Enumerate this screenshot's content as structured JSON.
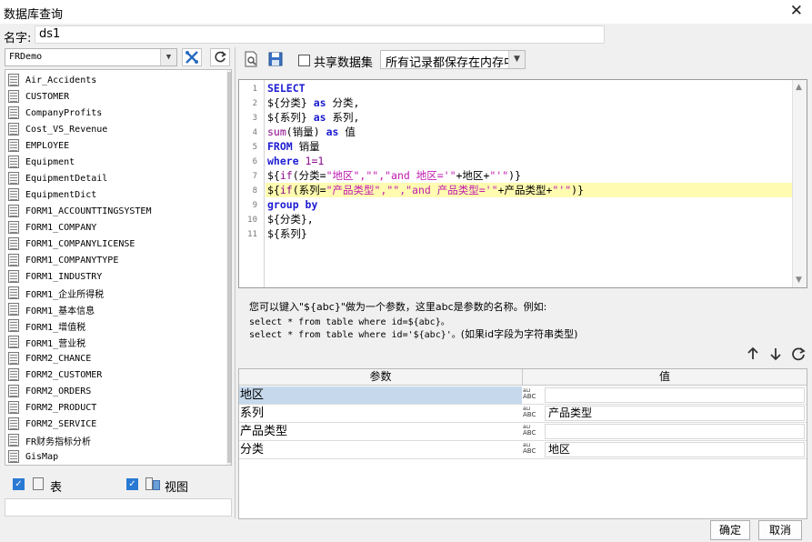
{
  "window": {
    "title": "数据库查询",
    "close_glyph": "✕"
  },
  "name_field": {
    "label": "名字:",
    "value": "ds1"
  },
  "datasource": {
    "selected": "FRDemo"
  },
  "left_icons": [
    "tools-icon",
    "refresh-icon"
  ],
  "tables": [
    "Air_Accidents",
    "CUSTOMER",
    "CompanyProfits",
    "Cost_VS_Revenue",
    "EMPLOYEE",
    "Equipment",
    "EquipmentDetail",
    "EquipmentDict",
    "FORM1_ACCOUNTTINGSYSTEM",
    "FORM1_COMPANY",
    "FORM1_COMPANYLICENSE",
    "FORM1_COMPANYTYPE",
    "FORM1_INDUSTRY",
    "FORM1_企业所得税",
    "FORM1_基本信息",
    "FORM1_增值税",
    "FORM1_营业税",
    "FORM2_CHANCE",
    "FORM2_CUSTOMER",
    "FORM2_ORDERS",
    "FORM2_PRODUCT",
    "FORM2_SERVICE",
    "FR财务指标分析",
    "GisMap"
  ],
  "filters": {
    "table_label": "表",
    "view_label": "视图"
  },
  "toolbar": {
    "share_label": "共享数据集",
    "mode_select": "所有记录都保存在内存中"
  },
  "sql": {
    "line_numbers": [
      "1",
      "2",
      "3",
      "4",
      "5",
      "6",
      "7",
      "8",
      "9",
      "10",
      "11"
    ],
    "lines": [
      [
        {
          "t": "SELECT",
          "c": "kw"
        }
      ],
      [
        {
          "t": "${分类} ",
          "c": ""
        },
        {
          "t": "as",
          "c": "kw"
        },
        {
          "t": " 分类,",
          "c": ""
        }
      ],
      [
        {
          "t": "${系列} ",
          "c": ""
        },
        {
          "t": "as",
          "c": "kw"
        },
        {
          "t": " 系列,",
          "c": ""
        }
      ],
      [
        {
          "t": "sum",
          "c": "fn"
        },
        {
          "t": "(销量) ",
          "c": ""
        },
        {
          "t": "as",
          "c": "kw"
        },
        {
          "t": " 值",
          "c": ""
        }
      ],
      [
        {
          "t": "FROM",
          "c": "kw"
        },
        {
          "t": " 销量",
          "c": ""
        }
      ],
      [
        {
          "t": "where",
          "c": "kw"
        },
        {
          "t": " 1=1",
          "c": "fn"
        }
      ],
      [
        {
          "t": "${",
          "c": ""
        },
        {
          "t": "if",
          "c": "fn"
        },
        {
          "t": "(分类=",
          "c": ""
        },
        {
          "t": "\"地区\",\"\",\"and 地区='\"",
          "c": "str"
        },
        {
          "t": "+地区+",
          "c": ""
        },
        {
          "t": "\"'\"",
          "c": "str"
        },
        {
          "t": ")}",
          "c": ""
        }
      ],
      [
        {
          "t": "${",
          "c": ""
        },
        {
          "t": "if",
          "c": "fn"
        },
        {
          "t": "(系列=",
          "c": ""
        },
        {
          "t": "\"产品类型\",\"\",\"and 产品类型='\"",
          "c": "str"
        },
        {
          "t": "+产品类型+",
          "c": ""
        },
        {
          "t": "\"'\"",
          "c": "str"
        },
        {
          "t": ")}",
          "c": ""
        }
      ],
      [
        {
          "t": "group by",
          "c": "kw"
        }
      ],
      [
        {
          "t": "${分类},",
          "c": ""
        }
      ],
      [
        {
          "t": "${系列}",
          "c": ""
        }
      ]
    ]
  },
  "hint": {
    "line1": "您可以键入\"${abc}\"做为一个参数，这里abc是参数的名称。例如:",
    "line2": "select * from table where id=${abc}。",
    "line3_code": "select * from table where id='${abc}'。",
    "line3_note": "(如果id字段为字符串类型)"
  },
  "params": {
    "col_name": "参数",
    "col_value": "值",
    "type_glyph": "ABC",
    "rows": [
      {
        "name": "地区",
        "value": ""
      },
      {
        "name": "系列",
        "value": "产品类型"
      },
      {
        "name": "产品类型",
        "value": ""
      },
      {
        "name": "分类",
        "value": "地区"
      }
    ]
  },
  "footer": {
    "ok": "确定",
    "cancel": "取消"
  }
}
